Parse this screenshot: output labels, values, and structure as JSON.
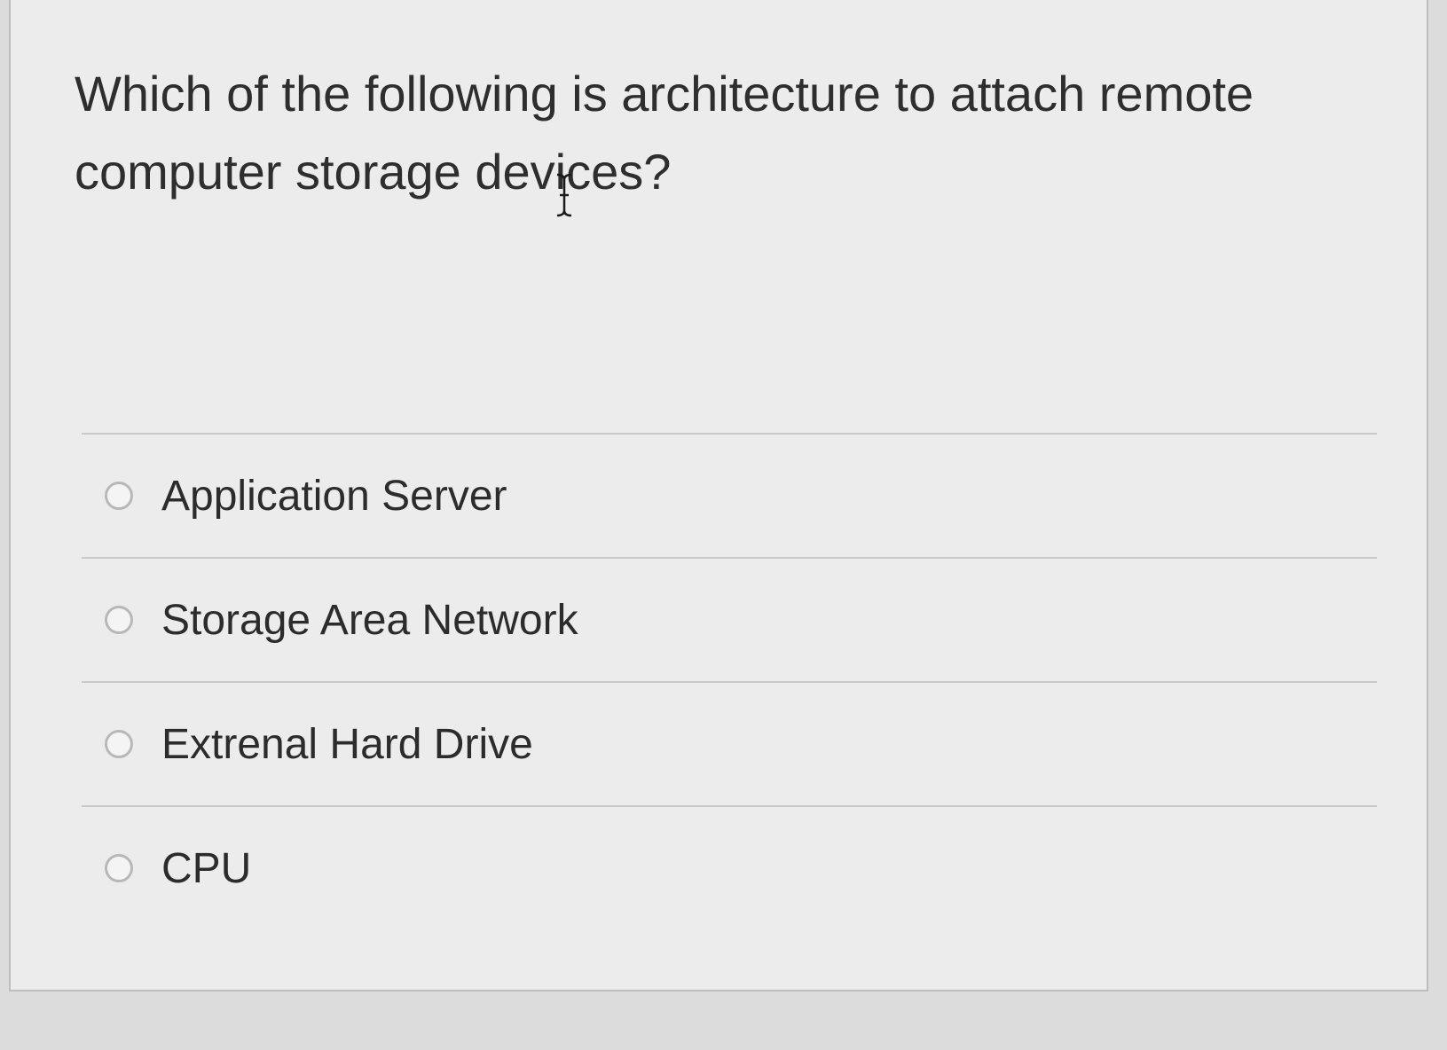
{
  "question": {
    "text": "Which of the following is architecture to attach remote computer storage devices?"
  },
  "answers": [
    {
      "label": "Application Server",
      "selected": false
    },
    {
      "label": "Storage Area Network",
      "selected": false
    },
    {
      "label": "Extrenal Hard Drive",
      "selected": false
    },
    {
      "label": "CPU",
      "selected": false
    }
  ],
  "icons": {
    "cursor": "i-beam-cursor-icon",
    "option": "radio-button-icon"
  },
  "colors": {
    "card_background": "#ececec",
    "text": "#2e2e2e",
    "divider": "#c9c9c9",
    "radio_border": "#b8b8b8"
  }
}
